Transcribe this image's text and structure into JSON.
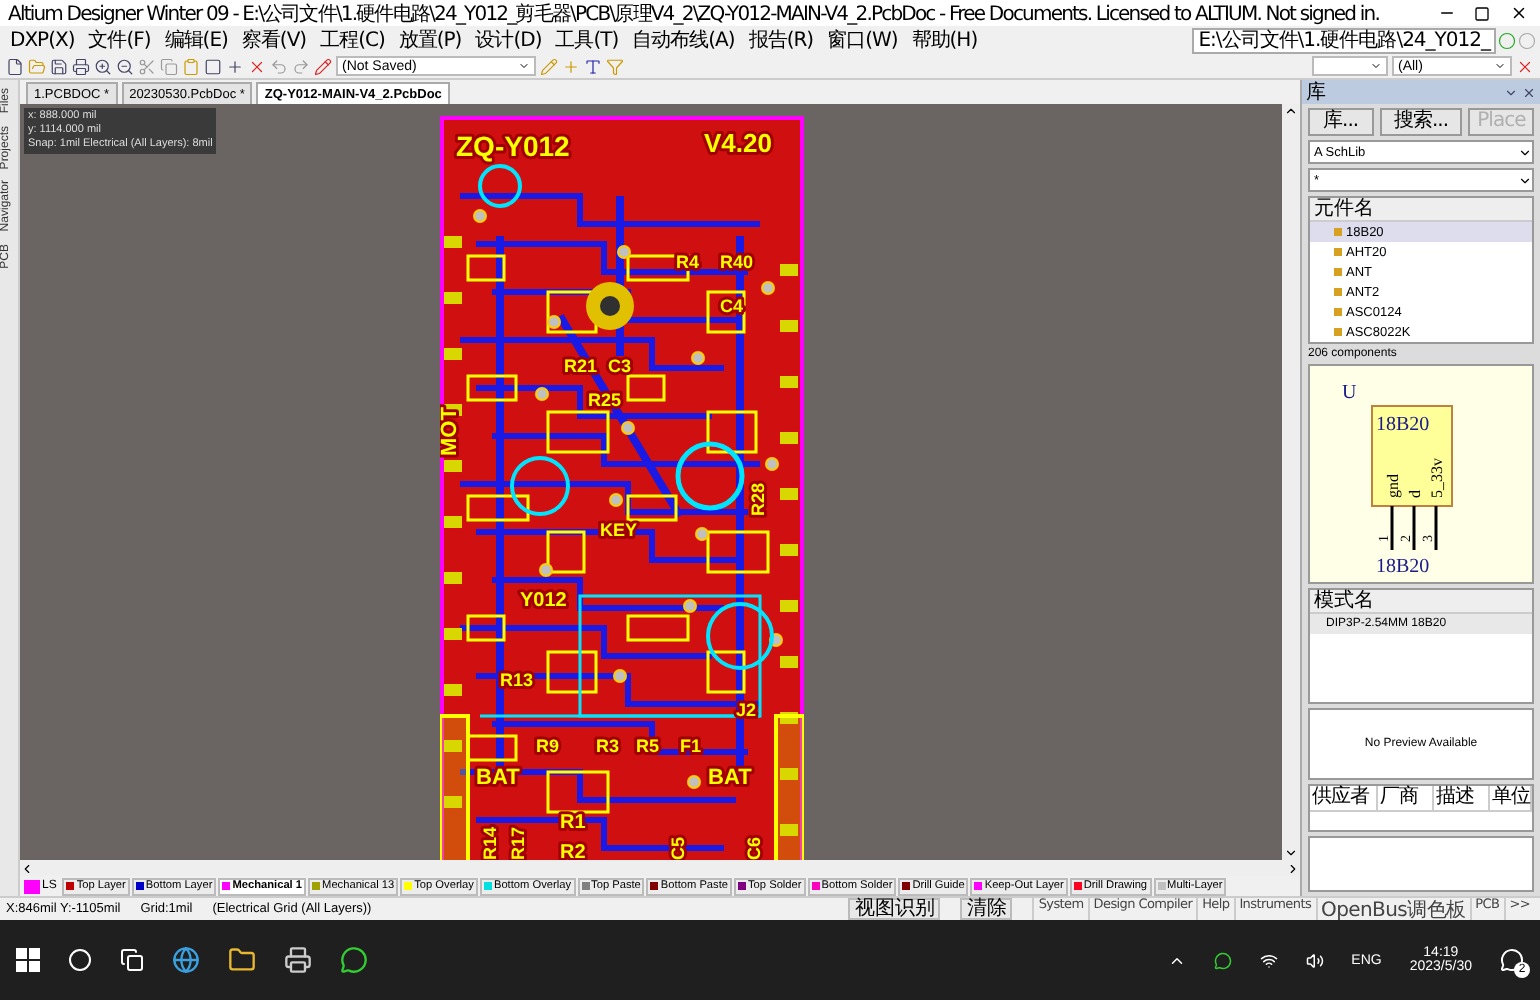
{
  "window": {
    "title": "Altium Designer Winter 09 - E:\\公司文件\\1.硬件电路\\24_Y012_剪毛器\\PCB\\原理V4_2\\ZQ-Y012-MAIN-V4_2.PcbDoc - Free Documents. Licensed to ALTIUM. Not signed in."
  },
  "menu": [
    "DXP(X)",
    "文件(F)",
    "编辑(E)",
    "察看(V)",
    "工程(C)",
    "放置(P)",
    "设计(D)",
    "工具(T)",
    "自动布线(A)",
    "报告(R)",
    "窗口(W)",
    "帮助(H)"
  ],
  "path_dropdown": {
    "value": "E:\\公司文件\\1.硬件电路\\24_Y012_"
  },
  "toolbar": {
    "view_config": "(Not Saved)",
    "filter": "(All)"
  },
  "document_tabs": [
    {
      "label": "1.PCBDOC *",
      "selected": false
    },
    {
      "label": "20230530.PcbDoc *",
      "selected": false
    },
    {
      "label": "ZQ-Y012-MAIN-V4_2.PcbDoc",
      "selected": true
    }
  ],
  "side_tabs": [
    "Files",
    "Projects",
    "Navigator",
    "PCB"
  ],
  "coordinates": [
    "x:   888.000 mil",
    "y:  1114.000 mil",
    "Snap: 1mil Electrical (All Layers): 8mil"
  ],
  "board_labels": [
    "ZQ-Y012",
    "V4.20",
    "R4",
    "R40",
    "C4",
    "R21",
    "C3",
    "R25",
    "MOT",
    "KEY",
    "R28",
    "Y012",
    "R13",
    "R9",
    "R3",
    "R5",
    "F1",
    "J2",
    "R14",
    "R17",
    "R1",
    "R2",
    "C5",
    "C6",
    "BAT",
    "BAT"
  ],
  "layer_set": "LS",
  "layer_tabs": [
    {
      "label": "Top Layer",
      "color": "#c00000",
      "selected": false
    },
    {
      "label": "Bottom Layer",
      "color": "#0000c8",
      "selected": false
    },
    {
      "label": "Mechanical 1",
      "color": "#ff00ff",
      "selected": true
    },
    {
      "label": "Mechanical 13",
      "color": "#a0a000",
      "selected": false
    },
    {
      "label": "Top Overlay",
      "color": "#ffff00",
      "selected": false
    },
    {
      "label": "Bottom Overlay",
      "color": "#00e0e0",
      "selected": false
    },
    {
      "label": "Top Paste",
      "color": "#808080",
      "selected": false
    },
    {
      "label": "Bottom Paste",
      "color": "#800000",
      "selected": false
    },
    {
      "label": "Top Solder",
      "color": "#800080",
      "selected": false
    },
    {
      "label": "Bottom Solder",
      "color": "#ff00c0",
      "selected": false
    },
    {
      "label": "Drill Guide",
      "color": "#800000",
      "selected": false
    },
    {
      "label": "Keep-Out Layer",
      "color": "#ff00ff",
      "selected": false
    },
    {
      "label": "Drill Drawing",
      "color": "#ff0020",
      "selected": false
    },
    {
      "label": "Multi-Layer",
      "color": "#c0c0c0",
      "selected": false
    }
  ],
  "layer_buttons": [
    "视图识别",
    "清除"
  ],
  "status_bar": {
    "position": "X:846mil Y:-1105mil",
    "grid": "Grid:1mil",
    "snap": "(Electrical Grid (All Layers))"
  },
  "library_panel": {
    "title": "库",
    "buttons": [
      {
        "label": "库...",
        "disabled": false
      },
      {
        "label": "搜索...",
        "disabled": false
      },
      {
        "label": "Place",
        "disabled": true
      }
    ],
    "library": "A SchLib",
    "filter": "*",
    "list_header": "元件名",
    "components": [
      {
        "name": "18B20",
        "selected": true
      },
      {
        "name": "AHT20",
        "selected": false
      },
      {
        "name": "ANT",
        "selected": false
      },
      {
        "name": "ANT2",
        "selected": false
      },
      {
        "name": "ASC0124",
        "selected": false
      },
      {
        "name": "ASC8022K",
        "selected": false
      }
    ],
    "count": "206 components",
    "symbol": {
      "designator": "U",
      "name": "18B20",
      "pins": [
        "gnd",
        "d",
        "5_33v"
      ],
      "pin_numbers": [
        "1",
        "2",
        "3"
      ],
      "comment": "18B20"
    },
    "model_header": "模式名",
    "models": [
      "DIP3P-2.54MM 18B20"
    ],
    "model_preview": "No Preview Available",
    "supplier_columns": [
      "供应者",
      "厂商",
      "描述",
      "单位"
    ]
  },
  "panel_tabs": [
    "System",
    "Design Compiler",
    "Help",
    "Instruments",
    "OpenBus调色板",
    "PCB",
    ">>"
  ],
  "taskbar": {
    "language": "ENG",
    "time": "14:19",
    "date": "2023/5/30",
    "notification_count": "2"
  }
}
